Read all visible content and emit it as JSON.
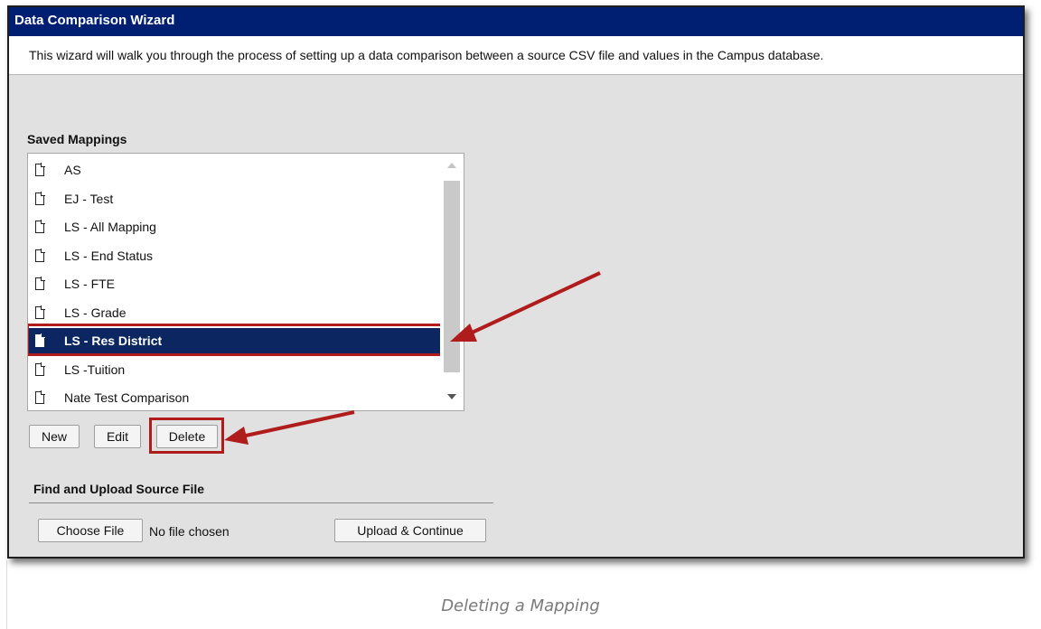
{
  "window": {
    "title": "Data Comparison Wizard",
    "intro": "This wizard will walk you through the process of setting up a data comparison between a source CSV file and values in the Campus database."
  },
  "saved_mappings": {
    "label": "Saved Mappings",
    "items": [
      {
        "label": "AS",
        "selected": false
      },
      {
        "label": "EJ - Test",
        "selected": false
      },
      {
        "label": "LS - All Mapping",
        "selected": false
      },
      {
        "label": "LS - End Status",
        "selected": false
      },
      {
        "label": "LS - FTE",
        "selected": false
      },
      {
        "label": "LS - Grade",
        "selected": false
      },
      {
        "label": "LS - Res District",
        "selected": true
      },
      {
        "label": "LS -Tuition",
        "selected": false
      },
      {
        "label": "Nate Test Comparison",
        "selected": false
      }
    ],
    "buttons": {
      "new": "New",
      "edit": "Edit",
      "delete": "Delete"
    }
  },
  "upload": {
    "label": "Find and Upload Source File",
    "choose_button": "Choose File",
    "file_status": "No file chosen",
    "upload_button": "Upload & Continue"
  },
  "caption": "Deleting a Mapping",
  "colors": {
    "titlebar": "#001f73",
    "selected_row": "#0b2660",
    "annotation": "#b01c1c"
  },
  "icons": {
    "list_item": "document-icon",
    "annotation": "arrow-pointer"
  }
}
